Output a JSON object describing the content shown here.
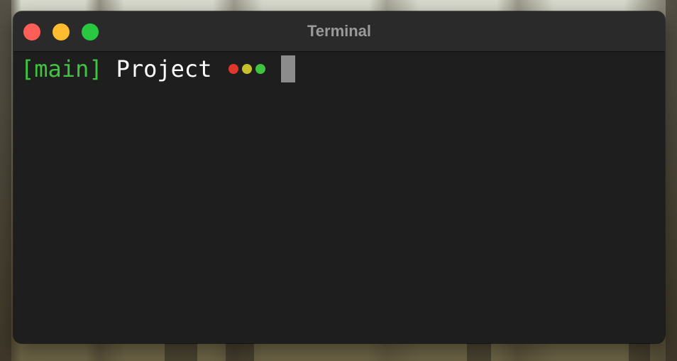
{
  "window": {
    "title": "Terminal"
  },
  "titlebar": {
    "buttons": [
      {
        "name": "close",
        "color": "#ff5f57"
      },
      {
        "name": "minimize",
        "color": "#febc2e"
      },
      {
        "name": "zoom",
        "color": "#28c840"
      }
    ]
  },
  "terminal": {
    "branch_text": "[main]",
    "directory_text": "Project",
    "status_dots": [
      {
        "color": "#e0372c"
      },
      {
        "color": "#c8c02a"
      },
      {
        "color": "#3fc43f"
      }
    ]
  },
  "colors": {
    "background": "#1e1e1e",
    "titlebar": "#2a2a2a",
    "branch": "#3fc43f",
    "directory": "#ffffff",
    "cursor": "#8c8c8c"
  }
}
